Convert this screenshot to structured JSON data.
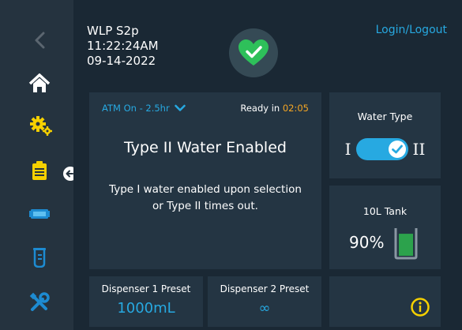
{
  "device": {
    "name": "WLP S2p",
    "time": "11:22:24AM",
    "date": "09-14-2022"
  },
  "header": {
    "login_label": "Login/Logout",
    "status_icon": "heart-check-icon"
  },
  "sidebar": {
    "items": [
      {
        "icon": "chevron-left-icon"
      },
      {
        "icon": "home-icon"
      },
      {
        "icon": "gears-icon"
      },
      {
        "icon": "clipboard-icon"
      },
      {
        "icon": "cartridge-icon"
      },
      {
        "icon": "beaker-icon"
      },
      {
        "icon": "tools-icon"
      }
    ]
  },
  "main_panel": {
    "atm_label": "ATM On -  2.5hr",
    "ready_label": "Ready in",
    "ready_time": "02:05",
    "title": "Type II Water Enabled",
    "description_line1": "Type I water enabled upon selection",
    "description_line2": "or Type II times out."
  },
  "water_type": {
    "label": "Water Type",
    "option_left": "I",
    "option_right": "II",
    "selected": "II"
  },
  "tank": {
    "label": "10L Tank",
    "level_text": "90%",
    "level": 0.9
  },
  "dispenser1": {
    "label": "Dispenser 1 Preset",
    "value": "1000mL"
  },
  "dispenser2": {
    "label": "Dispenser 2 Preset",
    "value": "∞"
  },
  "colors": {
    "accent": "#27a9e1",
    "status_green": "#2ec05a",
    "ready_time": "#f5a623",
    "background": "#1a2834",
    "sidebar": "#25333f",
    "panel": "#243543"
  }
}
